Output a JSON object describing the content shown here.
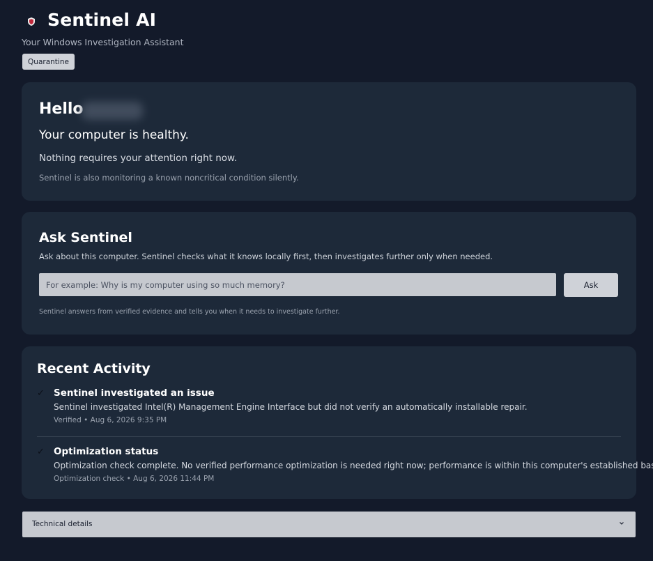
{
  "header": {
    "title": "Sentinel AI",
    "subtitle": "Your Windows Investigation Assistant",
    "quarantine_label": "Quarantine",
    "logo_icon": "shield-icon"
  },
  "hello_card": {
    "greeting": "Hello",
    "status": "Your computer is healthy.",
    "subtext": "Nothing requires your attention right now.",
    "note": "Sentinel is also monitoring a known noncritical condition silently."
  },
  "ask_card": {
    "title": "Ask Sentinel",
    "description": "Ask about this computer. Sentinel checks what it knows locally first, then investigates further only when needed.",
    "placeholder": "For example: Why is my computer using so much memory?",
    "button_label": "Ask",
    "footnote": "Sentinel answers from verified evidence and tells you when it needs to investigate further."
  },
  "activity": {
    "title": "Recent Activity",
    "items": [
      {
        "icon": "check-icon",
        "title": "Sentinel investigated an issue",
        "description": "Sentinel investigated Intel(R) Management Engine Interface but did not verify an automatically installable repair.",
        "meta": "Verified • Aug 6, 2026 9:35 PM"
      },
      {
        "icon": "check-icon",
        "title": "Optimization status",
        "description": "Optimization check complete. No verified performance optimization is needed right now; performance is within this computer's established baseline.",
        "meta": "Optimization check • Aug 6, 2026 11:44 PM"
      }
    ]
  },
  "technical_details": {
    "label": "Technical details",
    "icon": "chevron-down-icon"
  },
  "colors": {
    "background": "#131a2a",
    "card": "#1d2939",
    "button": "#cfd2d8",
    "input": "#c6c9cf",
    "logo_red": "#c0263a"
  }
}
